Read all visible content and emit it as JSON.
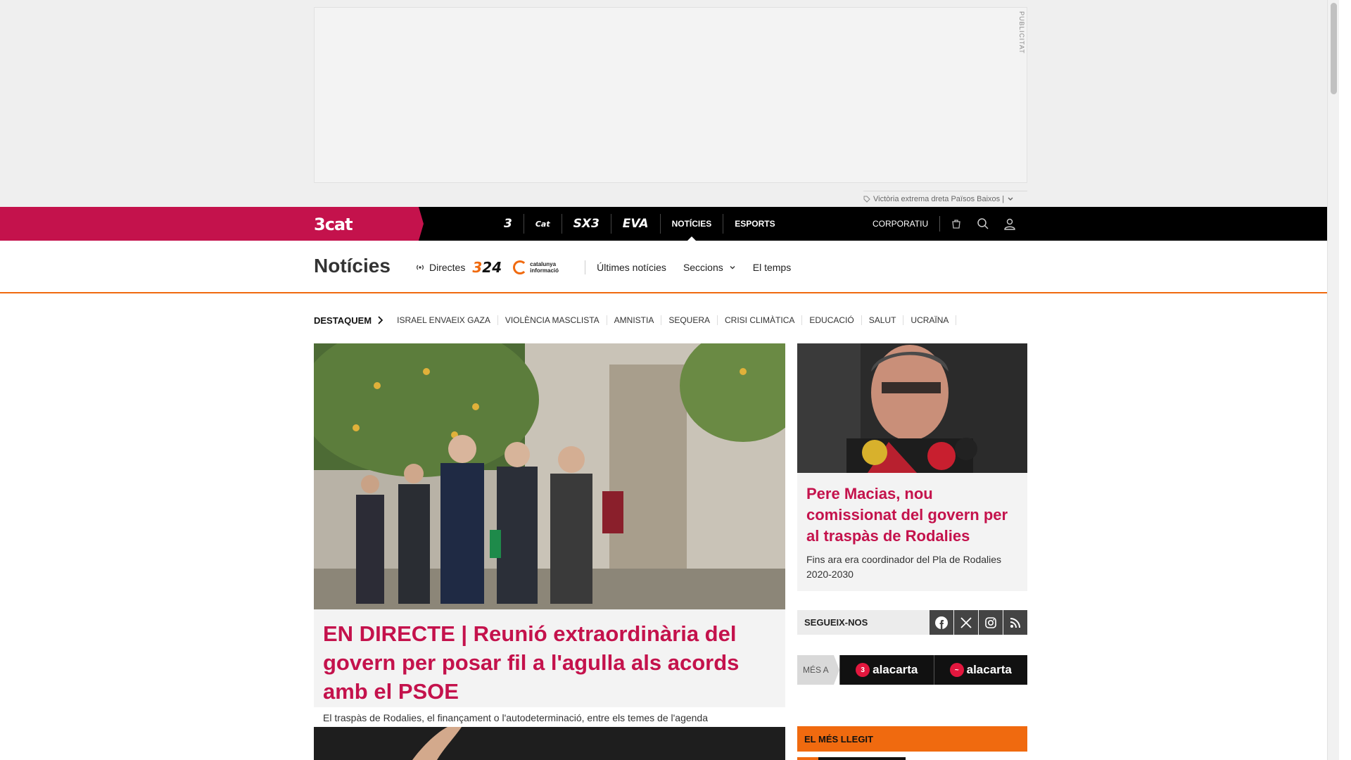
{
  "ad": {
    "label": "PUBLICITAT"
  },
  "ticker": {
    "text": "Victòria extrema dreta Països Baixos |"
  },
  "topnav": {
    "brand": "3cat",
    "items": [
      {
        "label": "3",
        "icon": "tv3-logo"
      },
      {
        "label": "Cat",
        "icon": "catradio-logo"
      },
      {
        "label": "SX3",
        "icon": "sx3-logo"
      },
      {
        "label": "EVA",
        "icon": "eva-logo"
      },
      {
        "label": "NOTÍCIES"
      },
      {
        "label": "ESPORTS"
      }
    ],
    "corporatiu": "CORPORATIU",
    "icons": [
      "shop-icon",
      "search-icon",
      "user-icon"
    ]
  },
  "section": {
    "title": "Notícies",
    "directes": "Directes",
    "logo324": "324",
    "catinfo": "catalunya informació",
    "links": [
      "Últimes notícies",
      "Seccions",
      "El temps"
    ]
  },
  "destaquem": {
    "head": "DESTAQUEM",
    "topics": [
      "ISRAEL ENVAEIX GAZA",
      "VIOLÈNCIA MASCLISTA",
      "AMNISTIA",
      "SEQUERA",
      "CRISI CLIMÀTICA",
      "EDUCACIÓ",
      "SALUT",
      "UCRAÏNA"
    ]
  },
  "main_article": {
    "title": "EN DIRECTE | Reunió extraordinària del govern per posar fil a l'agulla als acords amb el PSOE",
    "summary": "El traspàs de Rodalies, el finançament o l'autodeterminació, entre els temes de l'agenda"
  },
  "side_article": {
    "title": "Pere Macias, nou comissionat del govern per al traspàs de Rodalies",
    "summary": "Fins ara era coordinador del Pla de Rodalies 2020-2030"
  },
  "follow": {
    "label": "SEGUEIX-NOS",
    "icons": [
      "facebook-icon",
      "x-icon",
      "instagram-icon",
      "rss-icon"
    ]
  },
  "mesa": {
    "label": "MÉS A",
    "items": [
      "alacarta",
      "alacarta"
    ]
  },
  "mes_llegit": {
    "label": "EL MÉS LLEGIT"
  },
  "colors": {
    "brand": "#c4124c",
    "accent": "#f06a0f",
    "nav": "#000000"
  }
}
